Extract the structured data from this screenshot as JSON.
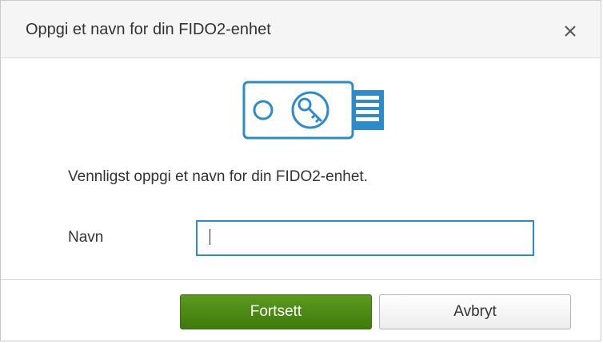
{
  "dialog": {
    "title": "Oppgi et navn for din FIDO2-enhet",
    "close_icon": "close-icon",
    "illustration_icon": "fido-security-key-icon",
    "description": "Vennligst oppgi et navn for din FIDO2-enhet.",
    "name_label": "Navn",
    "name_value": "",
    "continue_label": "Fortsett",
    "cancel_label": "Avbryt"
  },
  "colors": {
    "accent_blue": "#2e8bcb",
    "primary_green": "#4a8a14",
    "header_bg": "#f5f5f5"
  }
}
